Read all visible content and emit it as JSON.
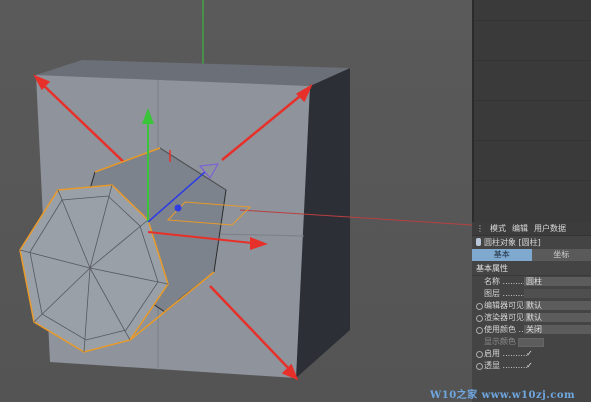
{
  "panel": {
    "menu": [
      "模式",
      "编辑",
      "用户数据"
    ],
    "object_title": "圆柱对象 [圆柱]",
    "tabs": [
      "基本",
      "坐标"
    ],
    "section_title": "基本属性",
    "properties": [
      {
        "label": "名称 ..........",
        "value": "圆柱"
      },
      {
        "label": "图层 ..........",
        "value": ""
      },
      {
        "label": "编辑器可见",
        "value": "默认"
      },
      {
        "label": "渲染器可见",
        "value": "默认"
      },
      {
        "label": "使用颜色 ....",
        "value": "关闭"
      },
      {
        "label": "显示颜色 ▾",
        "value": ""
      },
      {
        "label": "启用 ..........",
        "value": "✓"
      },
      {
        "label": "透显 ..........",
        "value": "✓"
      }
    ]
  },
  "viewport": {
    "axis_colors": {
      "x": "#e8302a",
      "y": "#39c43a",
      "z": "#2f3ee0"
    }
  },
  "watermark": "W10之家 www.w10zj.com"
}
